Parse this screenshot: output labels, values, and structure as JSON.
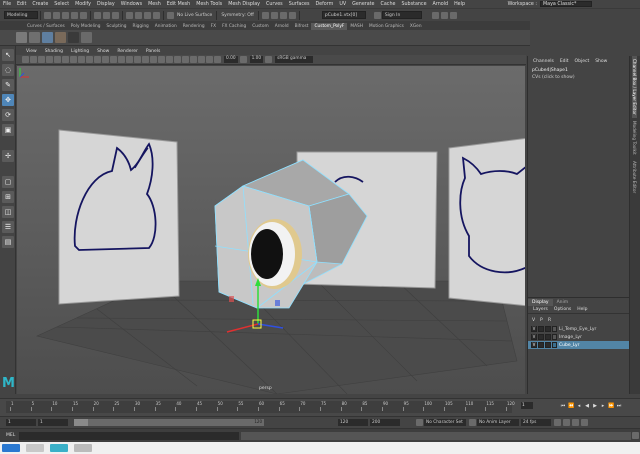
{
  "menubar": {
    "items": [
      "File",
      "Edit",
      "Create",
      "Select",
      "Modify",
      "Display",
      "Windows",
      "Mesh",
      "Edit Mesh",
      "Mesh Tools",
      "Mesh Display",
      "Curves",
      "Surfaces",
      "Deform",
      "UV",
      "Generate",
      "Cache",
      "Substance",
      "Arnold",
      "Help"
    ],
    "workspace_label": "Workspace :",
    "workspace_value": "Maya Classic*"
  },
  "statusline": {
    "mode": "Modeling",
    "live_surface": "No Live Surface",
    "symmetry": "Symmetry: Off",
    "object_field": "pCube1.vtx[0]",
    "sign_in": "Sign In"
  },
  "shelf": {
    "tabs": [
      "Curves / Surfaces",
      "Poly Modeling",
      "Sculpting",
      "Rigging",
      "Animation",
      "Rendering",
      "FX",
      "FX Caching",
      "Custom",
      "Arnold",
      "Bifrost",
      "Custom_PolyF",
      "MASH",
      "Motion Graphics",
      "XGen"
    ],
    "active_index": 11
  },
  "toolbox": {
    "tools": [
      "select-tool",
      "lasso-tool",
      "paint-select-tool",
      "move-tool",
      "rotate-tool",
      "scale-tool",
      "last-tool"
    ],
    "active_index": 3
  },
  "panel": {
    "menu": [
      "View",
      "Shading",
      "Lighting",
      "Show",
      "Renderer",
      "Panels"
    ],
    "field_a": "0.00",
    "field_b": "1.00",
    "colorspace": "sRGB gamma",
    "camera_label": "persp"
  },
  "channelbox": {
    "menu": [
      "Channels",
      "Edit",
      "Object",
      "Show"
    ],
    "object_name": "pCube4|Shape1",
    "shapes_text": "CVs (click to show)"
  },
  "right_tabs": [
    "Channel Box / Layer Editor",
    "Modeling Toolkit",
    "Attribute Editor"
  ],
  "layer_editor": {
    "tabs": [
      "Display",
      "Anim"
    ],
    "menu": [
      "Layers",
      "Options",
      "Help"
    ],
    "header": [
      "V",
      "P",
      "R"
    ],
    "layers": [
      {
        "name": "Li_Temp_Eye_Lyr",
        "selected": false,
        "color": "#555555"
      },
      {
        "name": "Image_Lyr",
        "selected": false,
        "color": "#555555"
      },
      {
        "name": "Cube_Lyr",
        "selected": true,
        "color": "#3a6f8f"
      }
    ]
  },
  "timeline": {
    "ticks": [
      "1",
      "5",
      "10",
      "15",
      "20",
      "25",
      "30",
      "35",
      "40",
      "45",
      "50",
      "55",
      "60",
      "65",
      "70",
      "75",
      "80",
      "85",
      "90",
      "95",
      "100",
      "105",
      "110",
      "115",
      "120"
    ],
    "current_frame": "1"
  },
  "range": {
    "start": "1",
    "start_inner": "1",
    "slider_end": "120",
    "end_inner": "120",
    "end": "200",
    "character_set": "No Character Set",
    "anim_layer": "No Anim Layer",
    "fps": "24 fps"
  },
  "cmdline": {
    "label": "MEL"
  },
  "colors": {
    "accent": "#4f86b8",
    "selection": "#5285a6",
    "maya_logo": "#2fb6c8",
    "wireframe": "#7fd3ff"
  }
}
